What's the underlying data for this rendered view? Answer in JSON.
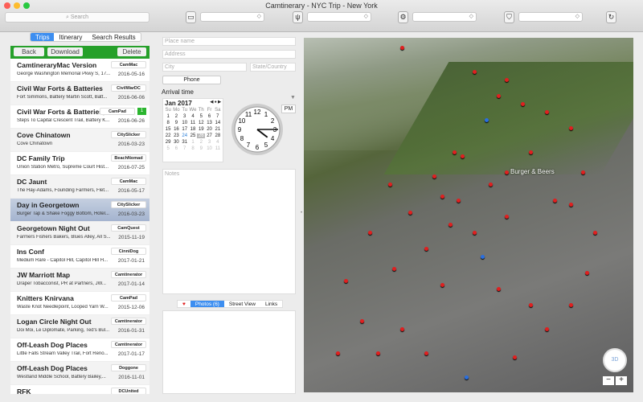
{
  "window": {
    "title": "Camtinerary - NYC Trip - New York"
  },
  "toolbar": {
    "search_placeholder": "Search",
    "icons": [
      "bed-icon",
      "fork-knife-icon",
      "landmark-icon",
      "shopping-bag-icon",
      "refresh-icon"
    ],
    "select_value": "◇"
  },
  "left": {
    "tabs": [
      "Trips",
      "Itinerary",
      "Search Results"
    ],
    "back": "Back",
    "download": "Download",
    "delete": "Delete",
    "trips": [
      {
        "name": "CamtineraryMac Version",
        "sub": "George Washington Memorial Pkwy S, 17...",
        "tag": "CamMac",
        "date": "2016-05-16"
      },
      {
        "name": "Civil War Forts & Batteries",
        "sub": "Fort Simmons, Battery Martin Scott, Batt...",
        "tag": "CivilWarDC",
        "date": "2016-06-06"
      },
      {
        "name": "Civil War Forts & Batteries, M",
        "sub": "Steps To Capital Crescent Trail, Battery K...",
        "tag": "CamPad",
        "date": "2016-06-26",
        "badge": "1"
      },
      {
        "name": "Cove Chinatown",
        "sub": "Cove Chinatown",
        "tag": "CitySlicker",
        "date": "2016-03-23"
      },
      {
        "name": "DC Family Trip",
        "sub": "Union Station Metro, Supreme Court Hist...",
        "tag": "BeachNomad",
        "date": "2016-07-25"
      },
      {
        "name": "DC Jaunt",
        "sub": "The Hay-Adams, Founding Farmers, Flet...",
        "tag": "CamMac",
        "date": "2016-05-17"
      },
      {
        "name": "Day in Georgetown",
        "sub": "Burger Tap & Shake Foggy Bottom, Hotel...",
        "tag": "CitySlicker",
        "date": "2016-03-23",
        "selected": true
      },
      {
        "name": "Georgetown Night Out",
        "sub": "Farmers Fishers Bakers, Blues Alley, All S...",
        "tag": "CamQuest",
        "date": "2015-11-19"
      },
      {
        "name": "Ins Conf",
        "sub": "Medium Rare - Capitol Hill, Capitol Hill H...",
        "tag": "CinniDog",
        "date": "2017-01-21"
      },
      {
        "name": "JW Marriott Map",
        "sub": "Draper Tobacconist, PR at Partners, JW...",
        "tag": "Camtinerator",
        "date": "2017-01-14"
      },
      {
        "name": "Knitters Knirvana",
        "sub": "Waste Knot Needlepoint, Looped Yarn W...",
        "tag": "CamPad",
        "date": "2015-12-06"
      },
      {
        "name": "Logan Circle Night Out",
        "sub": "Doi Moi, Le Diplomate, Parking, Ted's Bul...",
        "tag": "Camtinerator",
        "date": "2016-01-31"
      },
      {
        "name": "Off-Leash Dog Places",
        "sub": "Little Falls Stream Valley Trail, Fort Reno...",
        "tag": "Camtinerator",
        "date": "2017-01-17"
      },
      {
        "name": "Off-Leash Dog Places",
        "sub": "Westland Middle School, Battery Bailey,...",
        "tag": "Doggone",
        "date": "2016-11-01"
      },
      {
        "name": "RFK",
        "sub": "",
        "tag": "DCUnited",
        "date": ""
      }
    ]
  },
  "detail": {
    "place_name": "Place name",
    "address": "Address",
    "city": "City",
    "state": "State/Country",
    "phone": "Phone",
    "arrival": "Arrival time",
    "ampm": "PM",
    "notes": "Notes",
    "calendar": {
      "month": "Jan 2017",
      "nav": "◀ ● ▶",
      "days": [
        "Su",
        "Mo",
        "Tu",
        "We",
        "Th",
        "Fr",
        "Sa"
      ],
      "cells": [
        "1",
        "2",
        "3",
        "4",
        "5",
        "6",
        "7",
        "8",
        "9",
        "10",
        "11",
        "12",
        "13",
        "14",
        "15",
        "16",
        "17",
        "18",
        "19",
        "20",
        "21",
        "22",
        "23",
        "24",
        "25",
        "26",
        "27",
        "28",
        "29",
        "30",
        "31",
        "1",
        "2",
        "3",
        "4",
        "5",
        "6",
        "7",
        "8",
        "9",
        "10",
        "11"
      ],
      "today": "24",
      "selected": "26"
    },
    "clock": {
      "hour": 4,
      "minute": 15,
      "numbers": [
        "12",
        "1",
        "2",
        "3",
        "4",
        "5",
        "6",
        "7",
        "8",
        "9",
        "10",
        "11"
      ]
    },
    "tabs": {
      "heart": "♥",
      "photos": "Photos (6)",
      "street": "Street View",
      "links": "Links"
    }
  },
  "map": {
    "label": "Burger & Beers",
    "compass": "3D",
    "zoom_out": "−",
    "zoom_in": "+"
  },
  "colors": {
    "accent": "#3d8ef0",
    "green": "#26a02a",
    "pin": "#e02020"
  }
}
